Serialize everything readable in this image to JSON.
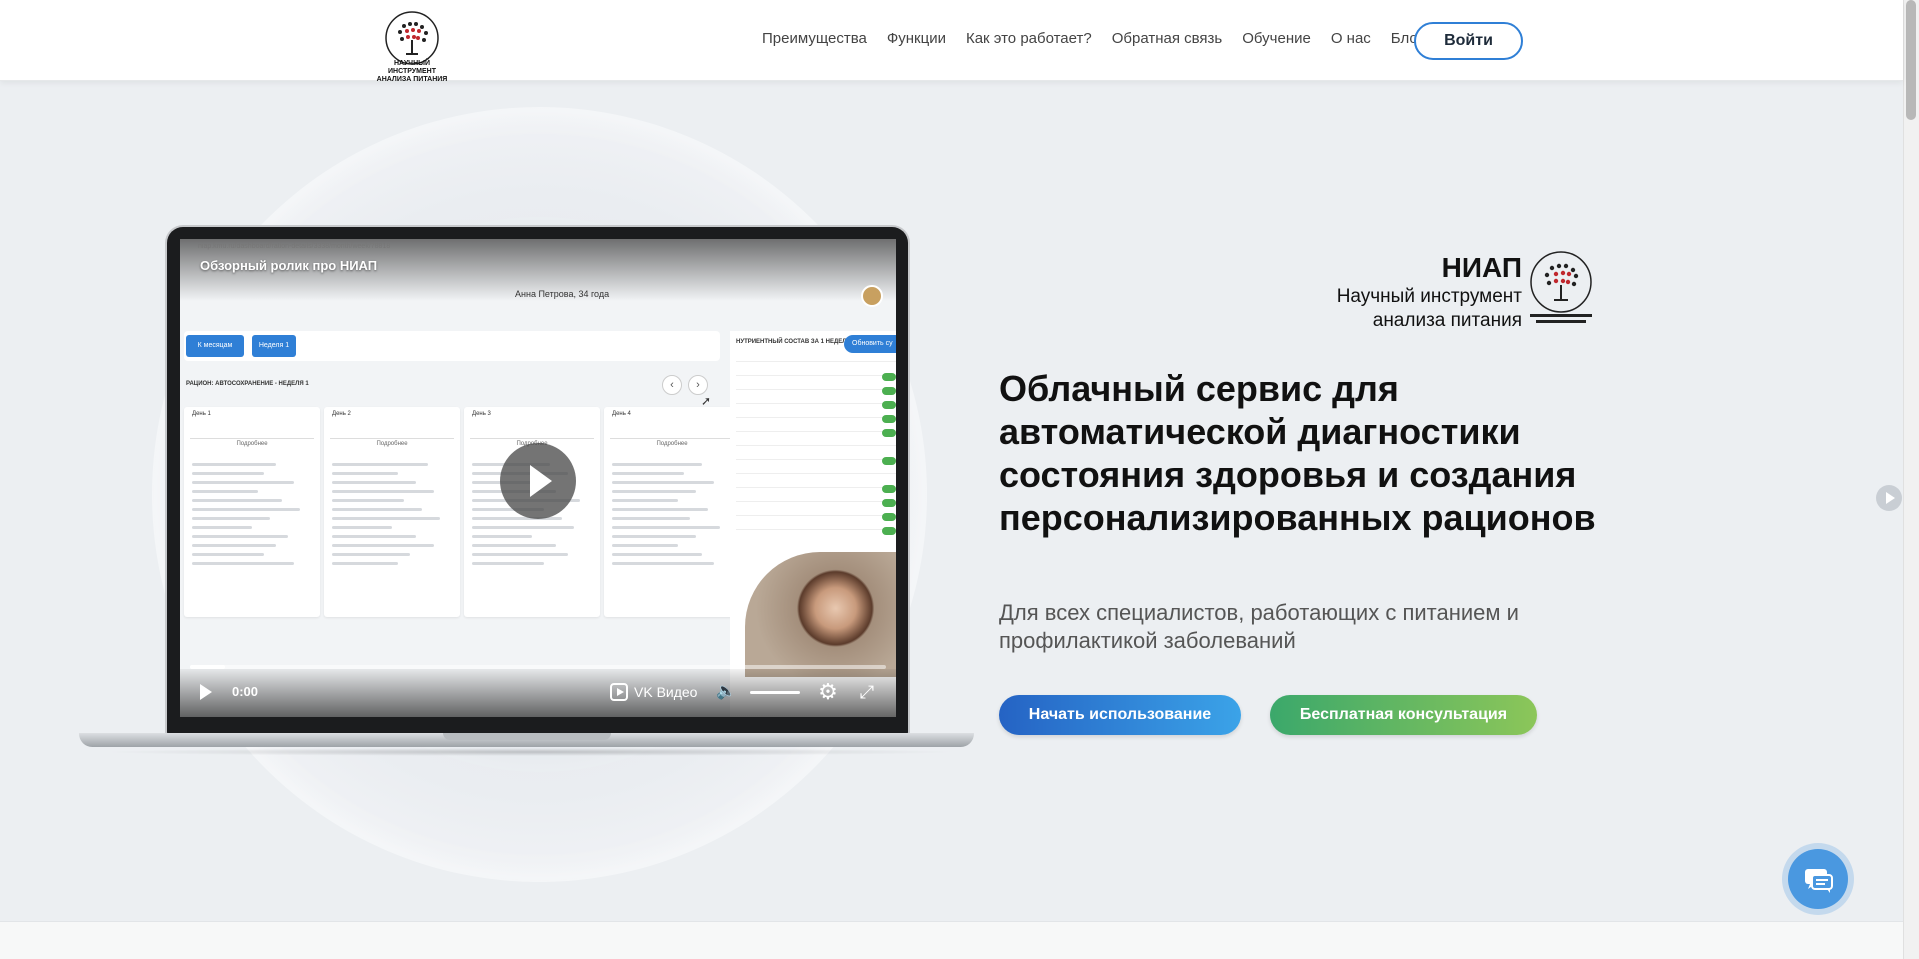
{
  "header": {
    "logo_caption": "НАУЧНЫЙ ИНСТРУМЕНТ АНАЛИЗА ПИТАНИЯ",
    "nav": [
      "Преимущества",
      "Функции",
      "Как это работает?",
      "Обратная связь",
      "Обучение",
      "О нас",
      "Блог"
    ],
    "login_label": "Войти"
  },
  "video": {
    "url": "niap.kmu.ru/dashboard/ration-details/3338/month/week/78818",
    "title": "Обзорный ролик про НИАП",
    "patient": "Анна Петрова, 34 года",
    "chip_months": "К месяцам",
    "chip_week": "Неделя 1",
    "week_title": "РАЦИОН: АВТОСОХРАНЕНИЕ - НЕДЕЛЯ 1",
    "days": [
      "День 1",
      "День 2",
      "День 3",
      "День 4"
    ],
    "more_label": "Подробнее",
    "nutrients_title": "НУТРИЕНТНЫЙ СОСТАВ ЗА 1 НЕДЕЛЮ",
    "refresh_label": "Обновить су",
    "time": "0:00",
    "progress": 0.05,
    "brand": "VK Видео"
  },
  "hero": {
    "brand_name": "НИАП",
    "brand_line1": "Научный инструмент",
    "brand_line2": "анализа питания",
    "headline": "Облачный сервис для автоматической диагностики состояния здоровья и создания персонализированных рационов",
    "subhead": "Для всех специалистов, работающих с питанием и профилактикой заболеваний",
    "btn_start": "Начать использование",
    "btn_consult": "Бесплатная консультация"
  },
  "icons": {
    "play": "play-icon",
    "volume": "volume-icon",
    "settings": "gear-icon",
    "fullscreen": "fullscreen-icon",
    "chat": "chat-icon"
  },
  "colors": {
    "accent": "#2f7fd6",
    "green": "#3ba86b",
    "hero_bg": "#eceff2"
  }
}
